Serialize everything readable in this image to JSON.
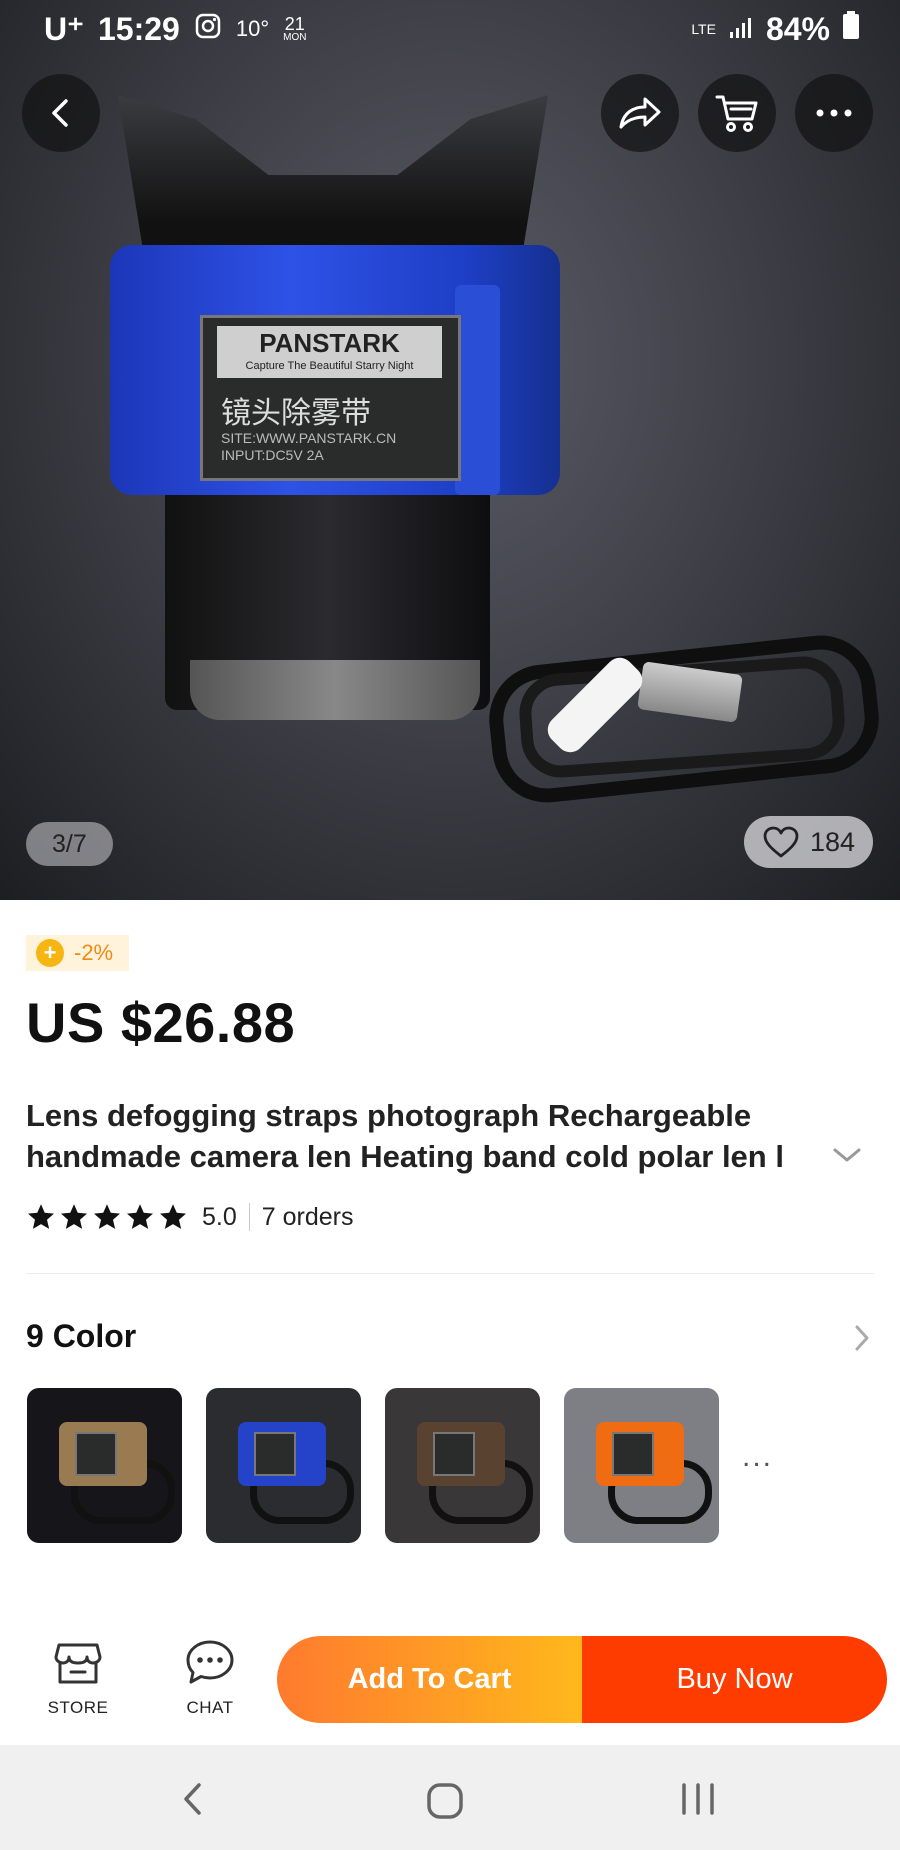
{
  "status_bar": {
    "carrier": "U⁺",
    "time": "15:29",
    "temperature": "10°",
    "date_num": "21",
    "date_day": "MON",
    "network": "LTE",
    "battery": "84%"
  },
  "gallery": {
    "page_indicator": "3/7",
    "wishlist_count": "184",
    "product_label": {
      "brand": "PANSTARK",
      "tagline": "Capture The Beautiful Starry Night",
      "chinese": "镜头除雾带",
      "site": "SITE:WWW.PANSTARK.CN",
      "input": "INPUT:DC5V 2A"
    }
  },
  "product": {
    "discount": "-2%",
    "price": "US $26.88",
    "title_line1": "Lens defogging straps photograph Rechargeable",
    "title_line2": "handmade camera len Heating band cold polar len l",
    "rating": "5.0",
    "stars": 5,
    "orders": "7 orders"
  },
  "variants": {
    "heading": "9 Color",
    "more": "...",
    "thumbs": [
      {
        "band_color": "#9a7a50",
        "bg": "#15151a"
      },
      {
        "band_color": "#2443c8",
        "bg": "#2b2c30"
      },
      {
        "band_color": "#5a4230",
        "bg": "#3a3738"
      },
      {
        "band_color": "#ef6c12",
        "bg": "#7e7f84"
      }
    ]
  },
  "action_bar": {
    "store_label": "STORE",
    "chat_label": "CHAT",
    "add_to_cart": "Add To Cart",
    "buy_now": "Buy Now"
  },
  "colors": {
    "accent_orange": "#ff7a2e",
    "accent_yellow": "#ffb81c",
    "buy_red": "#ff3c00",
    "discount_text": "#f08a12"
  }
}
